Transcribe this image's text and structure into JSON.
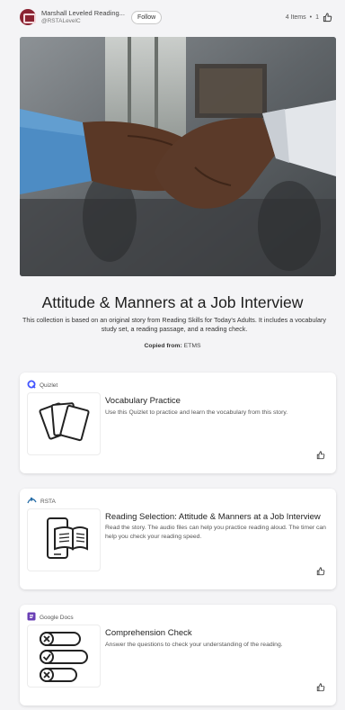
{
  "header": {
    "owner_name": "Marshall Leveled Reading...",
    "owner_handle": "@RSTALevelC",
    "follow_label": "Follow",
    "items_count": "4 Items",
    "separator": "•",
    "likes": "1"
  },
  "hero": {
    "alt": "Two people shaking hands"
  },
  "collection": {
    "title": "Attitude & Manners at a Job Interview",
    "description": "This collection is based on an original story from Reading Skills for Today's Adults. It includes a vocabulary study set, a reading passage, and a reading check.",
    "copied_label": "Copied from:",
    "copied_source": "ETMS"
  },
  "cards": [
    {
      "source": "Quizlet",
      "source_icon": "quizlet-icon",
      "title": "Vocabulary Practice",
      "description": "Use this Quizlet to practice and learn the vocabulary from this story.",
      "thumb_icon": "flashcards-icon"
    },
    {
      "source": "RSTA",
      "source_icon": "rsta-icon",
      "title": "Reading Selection: Attitude & Manners at a Job Interview",
      "description": "Read the story. The audio files can help you practice reading aloud. The timer can help you check your reading speed.",
      "thumb_icon": "phone-book-icon"
    },
    {
      "source": "Google Docs",
      "source_icon": "google-docs-icon",
      "title": "Comprehension Check",
      "description": "Answer the questions to check your understanding of the reading.",
      "thumb_icon": "checklist-icon"
    }
  ],
  "colors": {
    "brand_avatar": "#8b2332",
    "quizlet_blue": "#4255ff",
    "docs_purple": "#6a3fb5",
    "background": "#f4f4f6"
  }
}
